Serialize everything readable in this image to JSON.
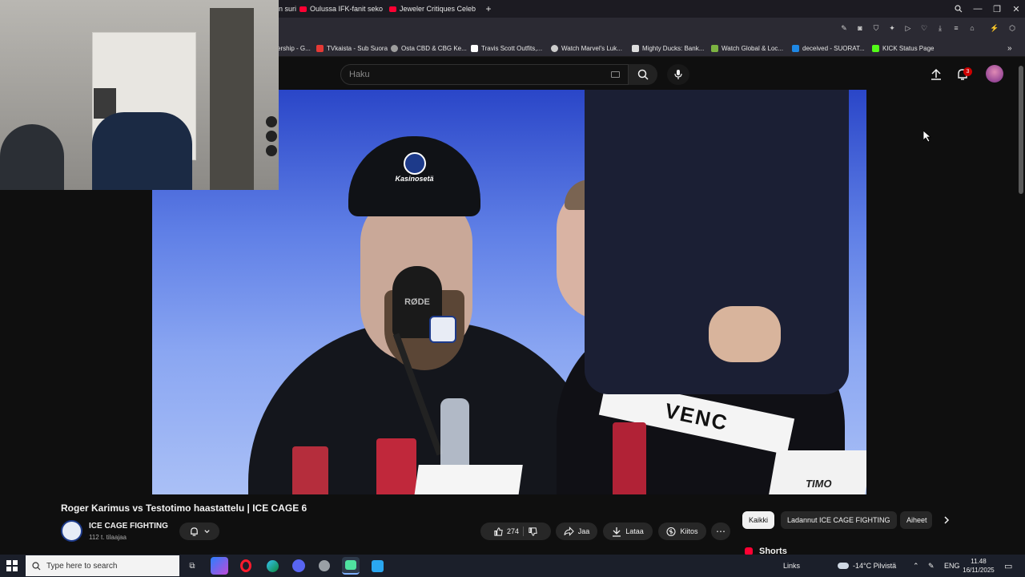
{
  "browser": {
    "tabs": [
      {
        "label": "n suri"
      },
      {
        "label": "Oulussa IFK-fanit sekoilee"
      },
      {
        "label": "Jeweler Critiques Celebrity"
      }
    ],
    "new_tab": "+",
    "window_controls": [
      "search",
      "minimize",
      "restore",
      "close"
    ]
  },
  "bookmarks": [
    {
      "label": "ership - G...",
      "color": "#4285f4"
    },
    {
      "label": "TVkaista - Sub Suora",
      "color": "#e53935"
    },
    {
      "label": "Osta CBD & CBG Ke...",
      "color": "#9e9e9e"
    },
    {
      "label": "Travis Scott Outfits,...",
      "color": "#ffffff"
    },
    {
      "label": "Watch Marvel's Luk...",
      "color": "#cccccc"
    },
    {
      "label": "Mighty Ducks: Bank...",
      "color": "#dddddd"
    },
    {
      "label": "Watch Global & Loc...",
      "color": "#7cb342"
    },
    {
      "label": "deceived - SUORAT...",
      "color": "#1e88e5"
    },
    {
      "label": "KICK Status Page",
      "color": "#53fc18"
    }
  ],
  "youtube": {
    "search_placeholder": "Haku",
    "notification_count": "3",
    "video": {
      "title": "Roger Karimus vs Testotimo haastattelu | ICE CAGE 6",
      "channel_name": "ICE CAGE FIGHTING",
      "subscribers": "112 t. tilaajaa",
      "like_count": "274",
      "share_label": "Jaa",
      "download_label": "Lataa",
      "thanks_label": "Kiitos",
      "logo_text": "Kasinosetä",
      "mic_text": "RØDE",
      "shirt_text": "VENC",
      "nameplate_text": "TIMO"
    },
    "chips": [
      "Kaikki",
      "Ladannut ICE CAGE FIGHTING",
      "Aiheet"
    ],
    "shorts_label": "Shorts"
  },
  "taskbar": {
    "search_placeholder": "Type here to search",
    "links_label": "Links",
    "weather": "-14°C  Pilvistä",
    "language": "ENG",
    "time": "11.48",
    "date": "16/11/2025"
  }
}
